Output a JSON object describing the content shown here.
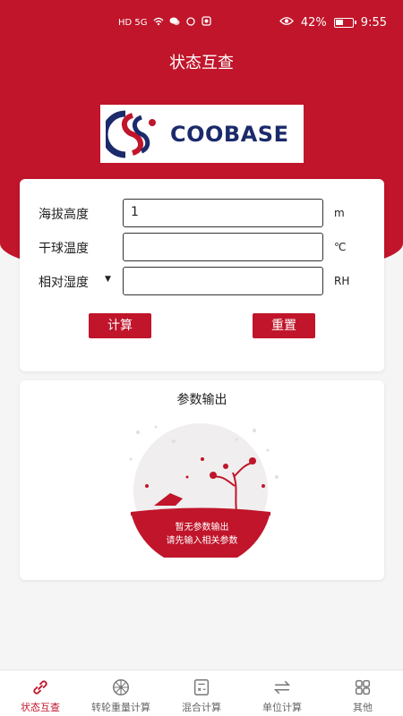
{
  "status_bar": {
    "network": "HD 5G",
    "battery": "42%",
    "time": "9:55"
  },
  "header": {
    "title": "状态互查"
  },
  "logo": {
    "text": "COOBASE"
  },
  "form": {
    "fields": [
      {
        "label": "海拔高度",
        "value": "1",
        "unit": "m"
      },
      {
        "label": "干球温度",
        "value": "",
        "unit": "℃"
      },
      {
        "label": "相对湿度",
        "value": "",
        "unit": "RH",
        "dropdown": true
      }
    ],
    "calc_button": "计算",
    "reset_button": "重置"
  },
  "output": {
    "title": "参数输出",
    "empty_line1": "暂无参数输出",
    "empty_line2": "请先输入相关参数"
  },
  "tabs": [
    {
      "label": "状态互查",
      "icon": "link-icon",
      "active": true
    },
    {
      "label": "转轮重量计算",
      "icon": "wheel-icon",
      "active": false
    },
    {
      "label": "混合计算",
      "icon": "calculator-icon",
      "active": false
    },
    {
      "label": "单位计算",
      "icon": "swap-arrows-icon",
      "active": false
    },
    {
      "label": "其他",
      "icon": "grid-icon",
      "active": false
    }
  ],
  "colors": {
    "primary": "#c0152a",
    "brand_navy": "#1b2a6b"
  }
}
